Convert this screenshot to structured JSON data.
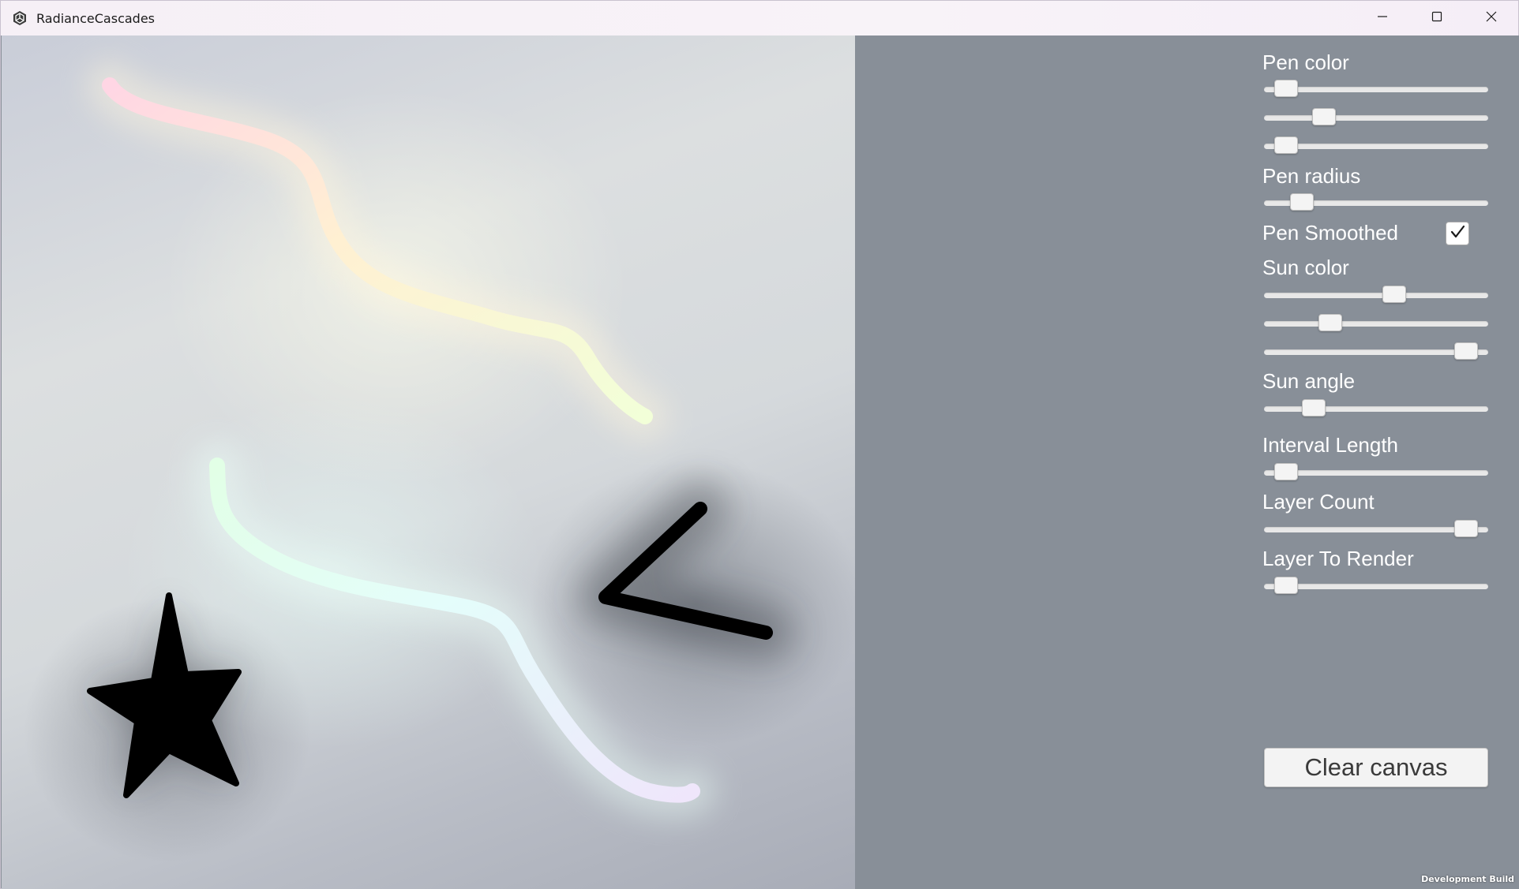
{
  "window": {
    "title": "RadianceCascades",
    "app_icon": "unity-icon",
    "controls": [
      "minimize-icon",
      "maximize-icon",
      "close-icon"
    ]
  },
  "panel": {
    "pen_color_label": "Pen color",
    "pen_color_values": [
      0.05,
      0.24,
      0.05
    ],
    "pen_radius_label": "Pen radius",
    "pen_radius_value": 0.13,
    "pen_smoothed_label": "Pen Smoothed",
    "pen_smoothed_checked": true,
    "sun_color_label": "Sun color",
    "sun_color_values": [
      0.59,
      0.27,
      0.95
    ],
    "sun_angle_label": "Sun angle",
    "sun_angle_value": 0.19,
    "interval_length_label": "Interval Length",
    "interval_length_value": 0.05,
    "layer_count_label": "Layer Count",
    "layer_count_value": 0.95,
    "layer_to_render_label": "Layer To Render",
    "layer_to_render_value": 0.05,
    "clear_button_label": "Clear canvas"
  },
  "footer": {
    "build_label": "Development Build"
  },
  "colors": {
    "panel_bg": "#888f98",
    "label_text": "#ffffff",
    "stroke_dark": "#000000"
  }
}
